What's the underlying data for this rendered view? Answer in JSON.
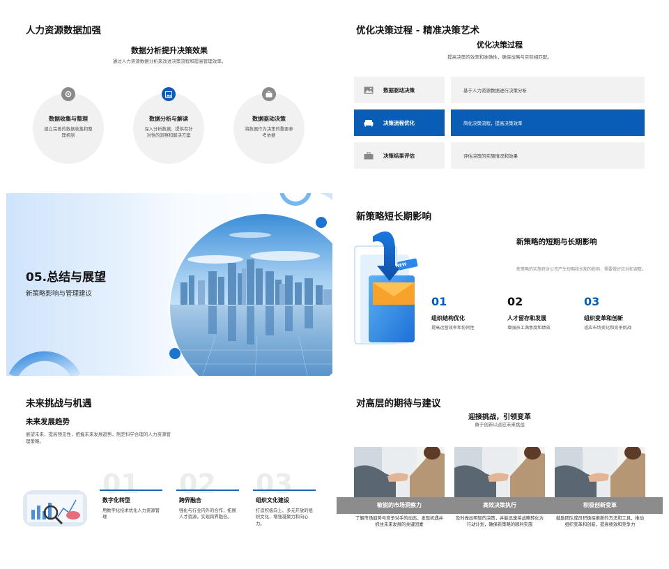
{
  "slide1": {
    "title": "人力资源数据加强",
    "subtitle": "数据分析提升决策效果",
    "intro": "通过人力资源数据分析来改进决策流程和提高管理效率。",
    "cards": [
      {
        "title": "数据收集与整理",
        "desc": "建立完善的数据收集和整理机制",
        "icon": "settings-icon",
        "color": "#8a8a8a"
      },
      {
        "title": "数据分析与解读",
        "desc": "深入分析数据，提供有针对性的洞察和解决方案",
        "icon": "image-icon",
        "color": "#0a5db5"
      },
      {
        "title": "数据驱动决策",
        "desc": "将数据作为决策的重要参考依据",
        "icon": "briefcase-icon",
        "color": "#8a8a8a"
      }
    ]
  },
  "slide2": {
    "title": "优化决策过程 - 精准决策艺术",
    "subtitle": "优化决策过程",
    "intro": "提高决策的效率和准确性，确保战略与实际相匹配。",
    "rows": [
      {
        "label": "数据驱动决策",
        "desc": "基于人力资源数据进行决策分析",
        "icon": "image-icon",
        "active": false
      },
      {
        "label": "决策流程优化",
        "desc": "简化决策流程，提高决策效率",
        "icon": "sofa-icon",
        "active": true
      },
      {
        "label": "决策结果评估",
        "desc": "评估决策的实施情况和效果",
        "icon": "briefcase-icon",
        "active": false
      }
    ]
  },
  "slide3": {
    "title": "05.总结与展望",
    "subtitle": "新策略影响与管理建议"
  },
  "slide4": {
    "title": "新策略短长期影响",
    "heading": "新策略的短期与长期影响",
    "intro": "新策略的实施将对公司产生短期和长期的影响，需要做好应对和调整。",
    "badge": "NEW",
    "items": [
      {
        "num": "01",
        "title": "组织结构优化",
        "desc": "提高运营效率和协同性",
        "color": "#0a5db5"
      },
      {
        "num": "02",
        "title": "人才留存和发展",
        "desc": "增强员工满意度和绩效",
        "color": "#111111"
      },
      {
        "num": "03",
        "title": "组织变革和创新",
        "desc": "适应市场变化和竞争挑战",
        "color": "#0a5db5"
      }
    ]
  },
  "slide5": {
    "title": "未来挑战与机遇",
    "subtitle": "未来发展趋势",
    "intro": "展望未来，提高预见性，把握未来发展趋势，制定科学合理的人力资源管理策略。",
    "items": [
      {
        "num": "01",
        "title": "数字化转型",
        "desc": "用数字化技术优化人力资源管理"
      },
      {
        "num": "02",
        "title": "跨界融合",
        "desc": "强化与行业内外的合作，拓展人才资源，实现跨界融合。"
      },
      {
        "num": "03",
        "title": "组织文化建设",
        "desc": "打造积极向上、多元开放的组织文化，增强凝聚力和向心力。"
      }
    ]
  },
  "slide6": {
    "title": "对高层的期待与建议",
    "heading": "迎接挑战，引领变革",
    "subheading": "勇于创新以适应未来挑战",
    "items": [
      {
        "title": "敏锐的市场洞察力",
        "desc": "了解市场趋势与竞争对手的动态，发现机遇并抓住未来发展的关键因素"
      },
      {
        "title": "高效决策执行",
        "desc": "及时做出明智的决策，并能迅速将战略转化为行动计划，确保新策略的顺利实施"
      },
      {
        "title": "积极创新变革",
        "desc": "鼓励团队成员积极探索新的方法和工具，推动组织变革和创新，提高绩效和竞争力"
      }
    ]
  },
  "colors": {
    "accent": "#0a5db5",
    "grey": "#8c8c8c"
  }
}
